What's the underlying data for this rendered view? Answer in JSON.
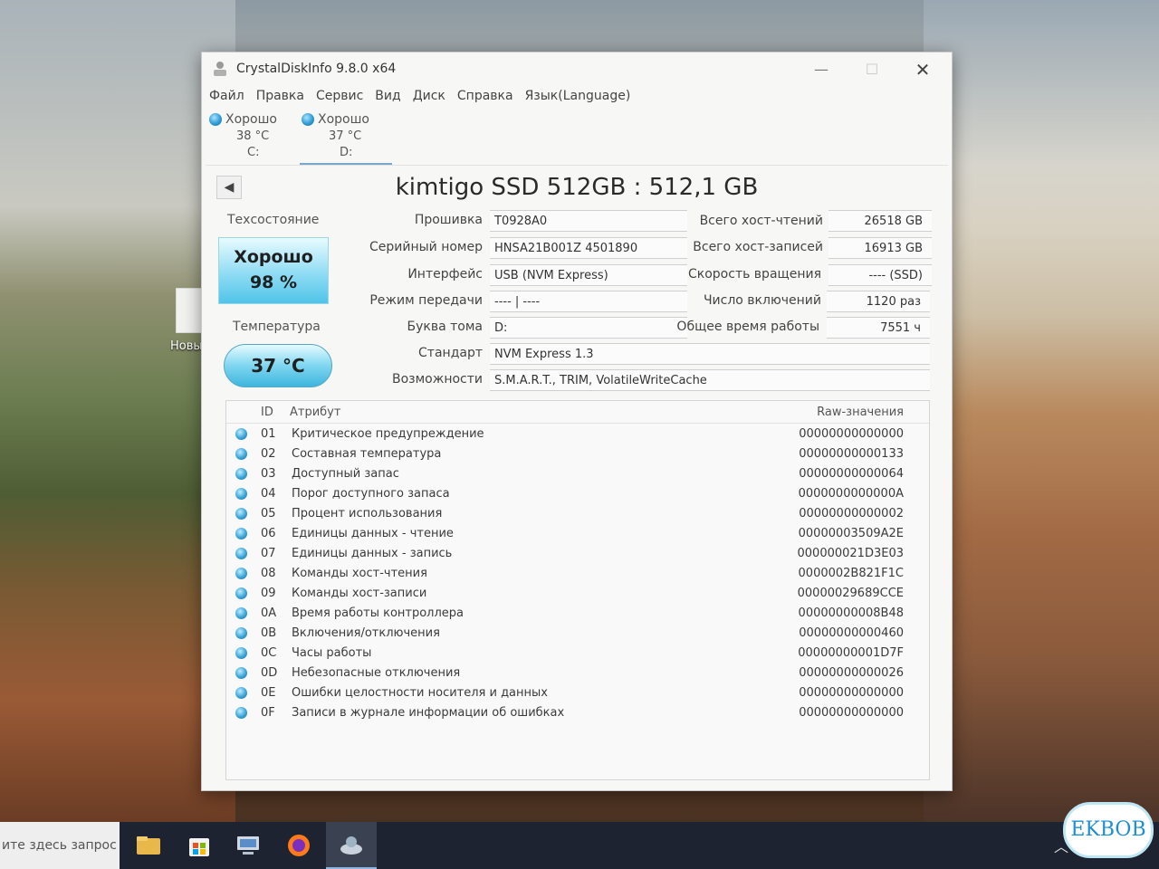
{
  "desktop": {
    "icon_label": "Новы текстов"
  },
  "window": {
    "title": "CrystalDiskInfo 9.8.0 x64",
    "controls": {
      "minimize": "—",
      "maximize": "☐",
      "close": "✕"
    },
    "menu": [
      "Файл",
      "Правка",
      "Сервис",
      "Вид",
      "Диск",
      "Справка",
      "Язык(Language)"
    ],
    "drives": [
      {
        "status": "Хорошо",
        "temp": "38 °C",
        "letter": "C:"
      },
      {
        "status": "Хорошо",
        "temp": "37 °C",
        "letter": "D:"
      }
    ],
    "back_glyph": "◀",
    "disk_title": "kimtigo SSD 512GB : 512,1 GB",
    "health": {
      "label": "Техсостояние",
      "status": "Хорошо",
      "percent": "98 %"
    },
    "temperature": {
      "label": "Температура",
      "value": "37 °C"
    },
    "info": {
      "firmware_label": "Прошивка",
      "firmware": "T0928A0",
      "serial_label": "Серийный номер",
      "serial": "HNSA21B001Z 4501890",
      "interface_label": "Интерфейс",
      "interface": "USB (NVM Express)",
      "transfer_label": "Режим передачи",
      "transfer": "---- | ----",
      "volume_label": "Буква тома",
      "volume": "D:",
      "standard_label": "Стандарт",
      "standard": "NVM Express 1.3",
      "features_label": "Возможности",
      "features": "S.M.A.R.T., TRIM, VolatileWriteCache"
    },
    "stats": {
      "host_reads_label": "Всего хост-чтений",
      "host_reads": "26518 GB",
      "host_writes_label": "Всего хост-записей",
      "host_writes": "16913 GB",
      "rotation_label": "Скорость вращения",
      "rotation": "---- (SSD)",
      "power_on_count_label": "Число включений",
      "power_on_count": "1120 раз",
      "power_on_hours_label": "Общее время работы",
      "power_on_hours": "7551 ч"
    },
    "attributes": {
      "headers": {
        "id": "ID",
        "attribute": "Атрибут",
        "raw": "Raw-значения"
      },
      "rows": [
        {
          "id": "01",
          "name": "Критическое предупреждение",
          "raw": "00000000000000"
        },
        {
          "id": "02",
          "name": "Составная температура",
          "raw": "00000000000133"
        },
        {
          "id": "03",
          "name": "Доступный запас",
          "raw": "00000000000064"
        },
        {
          "id": "04",
          "name": "Порог доступного запаса",
          "raw": "0000000000000A"
        },
        {
          "id": "05",
          "name": "Процент использования",
          "raw": "00000000000002"
        },
        {
          "id": "06",
          "name": "Единицы данных - чтение",
          "raw": "00000003509A2E"
        },
        {
          "id": "07",
          "name": "Единицы данных - запись",
          "raw": "000000021D3E03"
        },
        {
          "id": "08",
          "name": "Команды хост-чтения",
          "raw": "0000002B821F1C"
        },
        {
          "id": "09",
          "name": "Команды хост-записи",
          "raw": "00000029689CCE"
        },
        {
          "id": "0A",
          "name": "Время работы контроллера",
          "raw": "00000000008B48"
        },
        {
          "id": "0B",
          "name": "Включения/отключения",
          "raw": "00000000000460"
        },
        {
          "id": "0C",
          "name": "Часы работы",
          "raw": "00000000001D7F"
        },
        {
          "id": "0D",
          "name": "Небезопасные отключения",
          "raw": "00000000000026"
        },
        {
          "id": "0E",
          "name": "Ошибки целостности носителя и данных",
          "raw": "00000000000000"
        },
        {
          "id": "0F",
          "name": "Записи в журнале информации об ошибках",
          "raw": "00000000000000"
        }
      ]
    }
  },
  "taskbar": {
    "search_text": "ите здесь запрос",
    "icons": [
      "file-explorer-icon",
      "store-icon",
      "computer-icon",
      "firefox-icon",
      "crystaldiskinfo-icon"
    ],
    "tray_glyph": "︿"
  },
  "watermark": "EKBOB"
}
